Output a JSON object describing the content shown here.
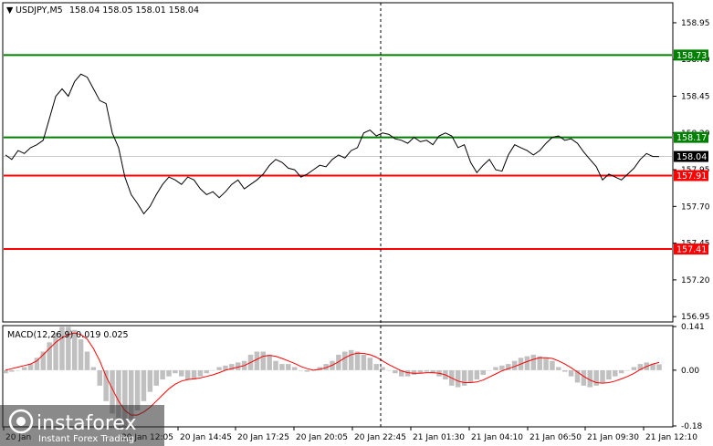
{
  "chart_data": [
    {
      "type": "line",
      "name": "price",
      "title": "USDJPY,M5",
      "ohlc": {
        "open": "158.04",
        "high": "158.05",
        "low": "158.01",
        "close": "158.04"
      },
      "ylim": [
        156.92,
        159.08
      ],
      "y_ticks": [
        "158.95",
        "158.70",
        "158.45",
        "158.20",
        "157.95",
        "157.70",
        "157.45",
        "157.20",
        "156.95"
      ],
      "current_price": {
        "value": 158.04,
        "label": "158.04",
        "color": "#000000"
      },
      "levels": [
        {
          "value": 158.73,
          "label": "158.73",
          "color": "#008000"
        },
        {
          "value": 158.17,
          "label": "158.17",
          "color": "#008000"
        },
        {
          "value": 157.91,
          "label": "157.91",
          "color": "#ff0000"
        },
        {
          "value": 157.41,
          "label": "157.41",
          "color": "#ff0000"
        }
      ],
      "points": [
        [
          0,
          158.05
        ],
        [
          1,
          158.02
        ],
        [
          2,
          158.08
        ],
        [
          3,
          158.06
        ],
        [
          4,
          158.1
        ],
        [
          5,
          158.12
        ],
        [
          6,
          158.15
        ],
        [
          7,
          158.3
        ],
        [
          8,
          158.45
        ],
        [
          9,
          158.5
        ],
        [
          10,
          158.45
        ],
        [
          11,
          158.55
        ],
        [
          12,
          158.6
        ],
        [
          13,
          158.58
        ],
        [
          14,
          158.5
        ],
        [
          15,
          158.42
        ],
        [
          16,
          158.4
        ],
        [
          17,
          158.2
        ],
        [
          18,
          158.1
        ],
        [
          19,
          157.9
        ],
        [
          20,
          157.78
        ],
        [
          21,
          157.72
        ],
        [
          22,
          157.65
        ],
        [
          23,
          157.7
        ],
        [
          24,
          157.78
        ],
        [
          25,
          157.85
        ],
        [
          26,
          157.9
        ],
        [
          27,
          157.88
        ],
        [
          28,
          157.85
        ],
        [
          29,
          157.9
        ],
        [
          30,
          157.88
        ],
        [
          31,
          157.82
        ],
        [
          32,
          157.78
        ],
        [
          33,
          157.8
        ],
        [
          34,
          157.76
        ],
        [
          35,
          157.8
        ],
        [
          36,
          157.85
        ],
        [
          37,
          157.88
        ],
        [
          38,
          157.82
        ],
        [
          39,
          157.85
        ],
        [
          40,
          157.88
        ],
        [
          41,
          157.92
        ],
        [
          42,
          157.98
        ],
        [
          43,
          158.02
        ],
        [
          44,
          158.0
        ],
        [
          45,
          157.96
        ],
        [
          46,
          157.95
        ],
        [
          47,
          157.9
        ],
        [
          48,
          157.92
        ],
        [
          49,
          157.95
        ],
        [
          50,
          157.98
        ],
        [
          51,
          157.97
        ],
        [
          52,
          158.02
        ],
        [
          53,
          158.05
        ],
        [
          54,
          158.03
        ],
        [
          55,
          158.08
        ],
        [
          56,
          158.1
        ],
        [
          57,
          158.2
        ],
        [
          58,
          158.22
        ],
        [
          59,
          158.18
        ],
        [
          60,
          158.2
        ],
        [
          61,
          158.19
        ],
        [
          62,
          158.16
        ],
        [
          63,
          158.15
        ],
        [
          64,
          158.13
        ],
        [
          65,
          158.17
        ],
        [
          66,
          158.14
        ],
        [
          67,
          158.15
        ],
        [
          68,
          158.12
        ],
        [
          69,
          158.18
        ],
        [
          70,
          158.2
        ],
        [
          71,
          158.18
        ],
        [
          72,
          158.1
        ],
        [
          73,
          158.12
        ],
        [
          74,
          158.0
        ],
        [
          75,
          157.93
        ],
        [
          76,
          157.98
        ],
        [
          77,
          158.02
        ],
        [
          78,
          157.95
        ],
        [
          79,
          157.94
        ],
        [
          80,
          158.05
        ],
        [
          81,
          158.12
        ],
        [
          82,
          158.1
        ],
        [
          83,
          158.08
        ],
        [
          84,
          158.05
        ],
        [
          85,
          158.08
        ],
        [
          86,
          158.13
        ],
        [
          87,
          158.17
        ],
        [
          88,
          158.18
        ],
        [
          89,
          158.15
        ],
        [
          90,
          158.16
        ],
        [
          91,
          158.13
        ],
        [
          92,
          158.07
        ],
        [
          93,
          158.02
        ],
        [
          94,
          157.97
        ],
        [
          95,
          157.88
        ],
        [
          96,
          157.92
        ],
        [
          97,
          157.9
        ],
        [
          98,
          157.88
        ],
        [
          99,
          157.92
        ],
        [
          100,
          157.96
        ],
        [
          101,
          158.02
        ],
        [
          102,
          158.06
        ],
        [
          103,
          158.04
        ],
        [
          104,
          158.04
        ]
      ]
    },
    {
      "type": "bar",
      "name": "MACD",
      "title": "MACD(12,26,9) 0.019 0.025",
      "ylim": [
        -0.18,
        0.141
      ],
      "y_ticks": [
        "0.141",
        "0.00",
        "-0.18"
      ],
      "histogram": [
        -0.01,
        -0.005,
        0.0,
        0.01,
        0.02,
        0.04,
        0.06,
        0.09,
        0.12,
        0.14,
        0.14,
        0.13,
        0.1,
        0.06,
        0.01,
        -0.05,
        -0.1,
        -0.14,
        -0.17,
        -0.18,
        -0.16,
        -0.13,
        -0.1,
        -0.07,
        -0.05,
        -0.03,
        -0.02,
        -0.01,
        -0.02,
        -0.03,
        -0.03,
        -0.02,
        -0.01,
        0.0,
        0.01,
        0.015,
        0.02,
        0.025,
        0.03,
        0.05,
        0.06,
        0.06,
        0.05,
        0.03,
        0.02,
        0.02,
        0.01,
        0.0,
        -0.005,
        0.0,
        0.01,
        0.02,
        0.03,
        0.05,
        0.06,
        0.065,
        0.06,
        0.05,
        0.04,
        0.02,
        0.01,
        0.0,
        -0.01,
        -0.02,
        -0.02,
        -0.015,
        -0.01,
        -0.005,
        -0.01,
        -0.02,
        -0.03,
        -0.05,
        -0.055,
        -0.05,
        -0.04,
        -0.03,
        -0.015,
        0.0,
        0.01,
        0.015,
        0.02,
        0.03,
        0.04,
        0.045,
        0.05,
        0.045,
        0.04,
        0.03,
        0.01,
        -0.005,
        -0.02,
        -0.04,
        -0.05,
        -0.055,
        -0.05,
        -0.04,
        -0.03,
        -0.02,
        -0.01,
        0.0,
        0.01,
        0.02,
        0.025,
        0.02,
        0.019
      ],
      "signal": [
        0.0,
        0.005,
        0.01,
        0.015,
        0.02,
        0.03,
        0.05,
        0.07,
        0.09,
        0.105,
        0.115,
        0.12,
        0.115,
        0.1,
        0.07,
        0.03,
        -0.02,
        -0.06,
        -0.1,
        -0.13,
        -0.145,
        -0.145,
        -0.135,
        -0.12,
        -0.1,
        -0.08,
        -0.06,
        -0.045,
        -0.035,
        -0.03,
        -0.028,
        -0.025,
        -0.02,
        -0.015,
        -0.008,
        0.0,
        0.005,
        0.01,
        0.015,
        0.025,
        0.035,
        0.045,
        0.048,
        0.045,
        0.038,
        0.03,
        0.022,
        0.012,
        0.005,
        0.0,
        0.003,
        0.008,
        0.016,
        0.027,
        0.04,
        0.05,
        0.055,
        0.054,
        0.05,
        0.042,
        0.03,
        0.018,
        0.008,
        -0.002,
        -0.008,
        -0.01,
        -0.01,
        -0.008,
        -0.008,
        -0.01,
        -0.015,
        -0.025,
        -0.035,
        -0.04,
        -0.04,
        -0.038,
        -0.032,
        -0.022,
        -0.012,
        -0.002,
        0.005,
        0.012,
        0.02,
        0.028,
        0.035,
        0.04,
        0.04,
        0.038,
        0.03,
        0.02,
        0.008,
        -0.006,
        -0.02,
        -0.032,
        -0.04,
        -0.042,
        -0.04,
        -0.035,
        -0.028,
        -0.02,
        -0.01,
        0.002,
        0.012,
        0.02,
        0.025
      ]
    }
  ],
  "x_axis_labels": [
    "20 Jan",
    "20 Jan 12:05",
    "20 Jan 14:45",
    "20 Jan 17:25",
    "20 Jan 20:05",
    "20 Jan 22:45",
    "21 Jan 01:30",
    "21 Jan 04:10",
    "21 Jan 06:50",
    "21 Jan 09:30",
    "21 Jan 12:10"
  ],
  "watermark": {
    "brand": "instaforex",
    "tagline": "Instant Forex Trading"
  },
  "toolbar": {
    "symbol_label": "USDJPY,M5",
    "ohlc_text": "158.04 158.05 158.01 158.04"
  },
  "colors": {
    "line": "#000000",
    "histogram": "#c0c0c0",
    "signal": "#ff0000",
    "grid": "#c8c8c8",
    "vline": "#000000"
  }
}
